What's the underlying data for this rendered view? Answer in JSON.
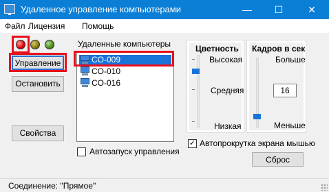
{
  "window": {
    "title": "Удаленное управление компьютерами",
    "app_icon": "monitor-icon",
    "controls": {
      "minimize": "—",
      "maximize": "☐",
      "close": "✕"
    }
  },
  "menu": {
    "file": "Файл",
    "license": "Лицензия",
    "help": "Помощь"
  },
  "status_leds": [
    {
      "name": "red",
      "color": "#e00000",
      "active": true
    },
    {
      "name": "yellow",
      "color": "#8a7a10",
      "active": false
    },
    {
      "name": "green",
      "color": "#4a8a14",
      "active": false
    }
  ],
  "buttons": {
    "control": "Управление",
    "stop": "Остановить",
    "properties": "Свойства",
    "reset": "Сброс"
  },
  "remote": {
    "label": "Удаленные компьютеры",
    "items": [
      {
        "name": "CO-009",
        "selected": true
      },
      {
        "name": "CO-010",
        "selected": false
      },
      {
        "name": "CO-016",
        "selected": false
      }
    ]
  },
  "autostart": {
    "label": "Автозапуск управления",
    "checked": false
  },
  "color_depth": {
    "title": "Цветность",
    "levels": {
      "high": "Высокая",
      "medium": "Средняя",
      "low": "Низкая"
    },
    "value": "high"
  },
  "fps": {
    "title": "Кадров в сек",
    "more": "Больше",
    "less": "Меньше",
    "value": "16",
    "slider_position": "low"
  },
  "autoscroll": {
    "label": "Автопрокрутка экрана мышью",
    "checked": true,
    "check_glyph": "✓"
  },
  "status": {
    "text": "Соединение: \"Прямое\""
  },
  "colors": {
    "title_bar": "#0b7ed6",
    "selection": "#1a73d9",
    "highlight_frame": "#e8101a"
  }
}
